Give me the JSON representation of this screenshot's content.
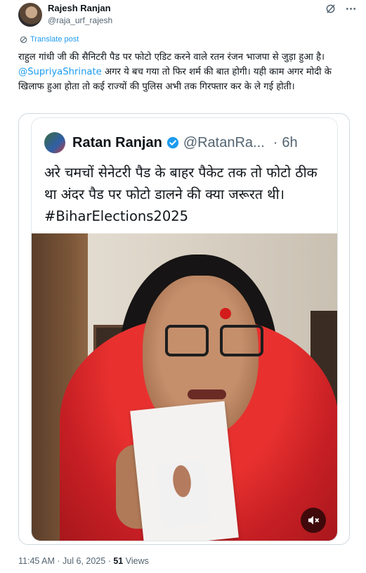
{
  "author": {
    "display_name": "Rajesh Ranjan",
    "handle": "@raja_urf_rajesh"
  },
  "header_icons": [
    "grok-icon",
    "more-icon"
  ],
  "translate_label": "Translate post",
  "post": {
    "text_part1": "राहुल गांधी जी की सैनिटरी पैड पर फोटो एडिट करने वाले रतन रंजन भाजपा से जुड़ा हुआ है। ",
    "mention": "@SupriyaShrinate",
    "text_part2": " अगर ये बच गया तो फिर शर्म की बात होगी। यही काम अगर मोदी के खिलाफ हुआ होता तो कई राज्यों की पुलिस अभी तक गिरफ्तार कर के ले गई होती।"
  },
  "quoted": {
    "display_name": "Ratan Ranjan",
    "handle": "@RatanRa...",
    "separator": "·",
    "time": "6h",
    "text": "अरे चमचों सेनेटरी पैड के बाहर पैकेट तक तो फोटो ठीक था अंदर पैड पर फोटो डालने की क्या जरूरत थी। #BiharElections2025"
  },
  "media": {
    "mute_icon": "volume-muted-icon"
  },
  "meta": {
    "time": "11:45 AM",
    "separator": "·",
    "date": "Jul 6, 2025",
    "separator2": "·",
    "views_count": "51",
    "views_label": "Views"
  },
  "colors": {
    "link": "#1d9bf0",
    "secondary_text": "#536471",
    "verified": "#1d9bf0"
  }
}
